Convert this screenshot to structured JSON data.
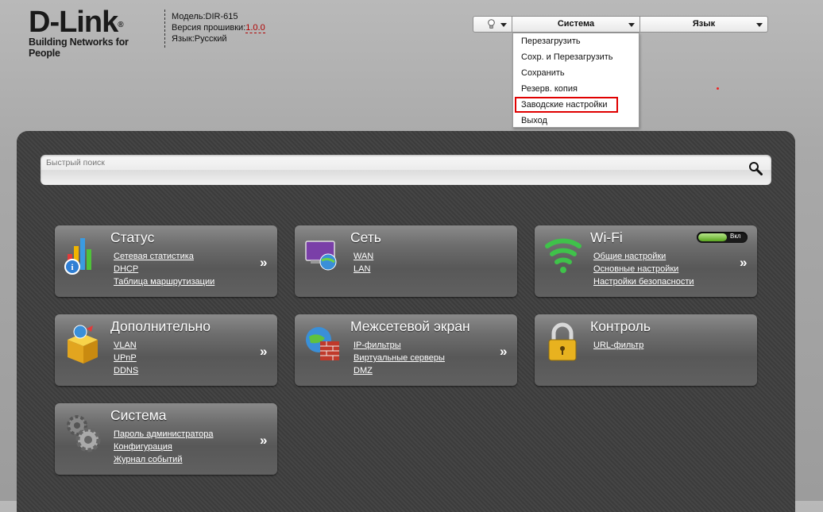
{
  "header": {
    "logo": "D-Link",
    "logo_reg": "®",
    "tagline": "Building Networks for People",
    "model_label": "Модель:",
    "model": "DIR-615",
    "firmware_label": "Версия прошивки:",
    "firmware": "1.0.0",
    "language_label": "Язык:",
    "language": "Русский"
  },
  "topmenu": {
    "system": "Система",
    "language": "Язык"
  },
  "system_menu": {
    "items": [
      {
        "label": "Перезагрузить"
      },
      {
        "label": "Сохр. и Перезагрузить"
      },
      {
        "label": "Сохранить"
      },
      {
        "label": "Резерв. копия"
      },
      {
        "label": "Заводские настройки"
      },
      {
        "label": "Выход"
      }
    ]
  },
  "search": {
    "placeholder": "Быстрый поиск"
  },
  "tiles": [
    {
      "title": "Статус",
      "links": [
        "Сетевая статистика",
        "DHCP",
        "Таблица маршрутизации"
      ],
      "arrow": "»"
    },
    {
      "title": "Сеть",
      "links": [
        "WAN",
        "LAN"
      ]
    },
    {
      "title": "Wi-Fi",
      "links": [
        "Общие настройки",
        "Основные настройки",
        "Настройки безопасности"
      ],
      "arrow": "»",
      "toggle": "Вкл"
    },
    {
      "title": "Дополнительно",
      "links": [
        "VLAN",
        "UPnP",
        "DDNS"
      ],
      "arrow": "»"
    },
    {
      "title": "Межсетевой экран",
      "links": [
        "IP-фильтры",
        "Виртуальные серверы",
        "DMZ"
      ],
      "arrow": "»"
    },
    {
      "title": "Контроль",
      "links": [
        "URL-фильтр"
      ]
    },
    {
      "title": "Система",
      "links": [
        "Пароль администратора",
        "Конфигурация",
        "Журнал событий"
      ],
      "arrow": "»"
    }
  ],
  "colors": {
    "highlight_border": "#e00000",
    "firmware_link": "#b00000",
    "panel_bg": "#3f3f3f"
  }
}
